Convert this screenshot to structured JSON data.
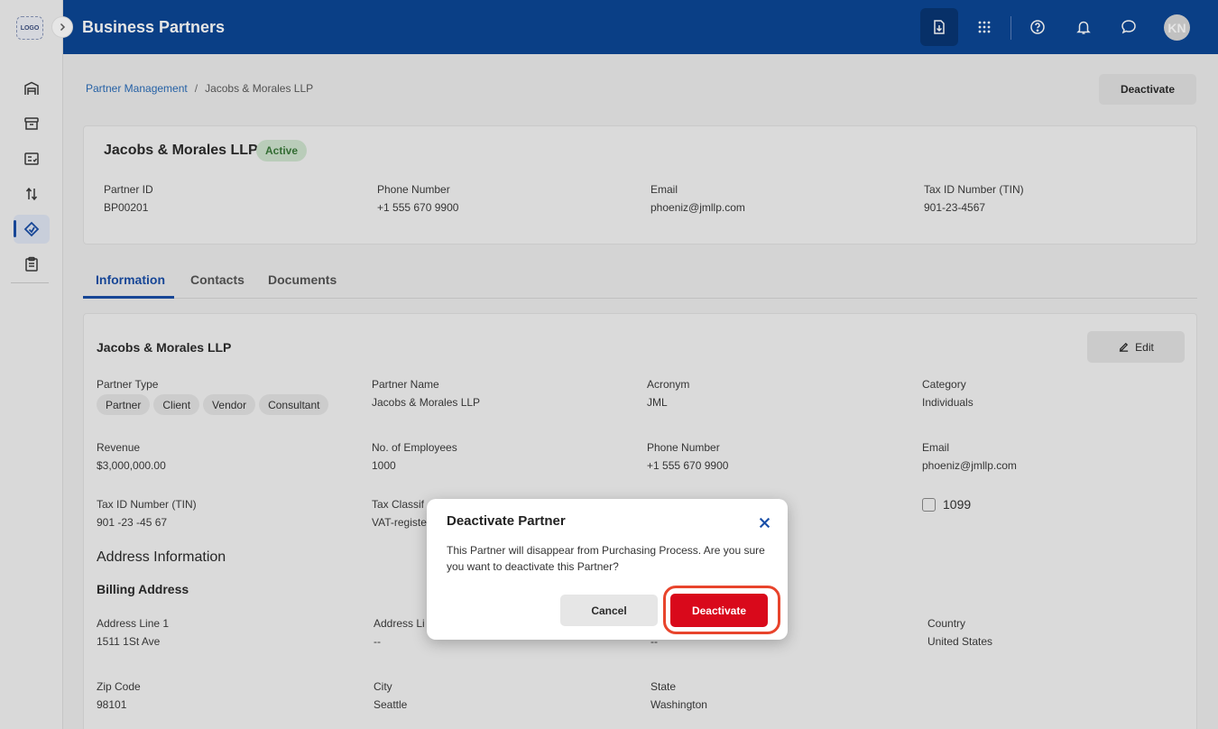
{
  "sidebar": {
    "logo_text": "LOGO",
    "items": [
      {
        "icon": "warehouse-icon"
      },
      {
        "icon": "archive-icon"
      },
      {
        "icon": "checklist-icon"
      },
      {
        "icon": "sort-icon"
      },
      {
        "icon": "partner-tag-icon",
        "active": true
      },
      {
        "icon": "clipboard-icon"
      }
    ]
  },
  "header": {
    "title": "Business Partners",
    "avatar_initials": "KN"
  },
  "breadcrumb": {
    "parent": "Partner Management",
    "separator": "/",
    "current": "Jacobs & Morales LLP"
  },
  "actions": {
    "deactivate_label": "Deactivate"
  },
  "partner": {
    "name": "Jacobs & Morales LLP",
    "status": "Active",
    "fields": [
      {
        "label": "Partner ID",
        "value": "BP00201"
      },
      {
        "label": "Phone Number",
        "value": "+1 555 670 9900"
      },
      {
        "label": "Email",
        "value": "phoeniz@jmllp.com"
      },
      {
        "label": "Tax ID Number (TIN)",
        "value": "901-23-4567"
      }
    ]
  },
  "tabs": [
    {
      "label": "Information",
      "active": true
    },
    {
      "label": "Contacts"
    },
    {
      "label": "Documents"
    }
  ],
  "info": {
    "title": "Jacobs & Morales LLP",
    "edit_label": "Edit",
    "partner_type_label": "Partner Type",
    "partner_types": [
      "Partner",
      "Client",
      "Vendor",
      "Consultant"
    ],
    "partner_name_label": "Partner Name",
    "partner_name_value": "Jacobs & Morales LLP",
    "acronym_label": "Acronym",
    "acronym_value": "JML",
    "category_label": "Category",
    "category_value": "Individuals",
    "revenue_label": "Revenue",
    "revenue_value": "$3,000,000.00",
    "employees_label": "No. of Employees",
    "employees_value": "1000",
    "phone_label": "Phone Number",
    "phone_value": "+1 555 670 9900",
    "email_label": "Email",
    "email_value": "phoeniz@jmllp.com",
    "tin_label": "Tax ID Number (TIN)",
    "tin_value": "901 -23 -45 67",
    "tax_class_label": "Tax Classif",
    "tax_class_value": "VAT-registe",
    "checkbox_label": "1099",
    "checkbox_checked": false
  },
  "address": {
    "section_title": "Address Information",
    "billing_title": "Billing Address",
    "line1_label": "Address Line 1",
    "line1_value": "1511 1St Ave",
    "line2_label": "Address Li",
    "line2_value": "--",
    "col3_value": "--",
    "country_label": "Country",
    "country_value": "United States",
    "zip_label": "Zip Code",
    "zip_value": "98101",
    "city_label": "City",
    "city_value": "Seattle",
    "state_label": "State",
    "state_value": "Washington"
  },
  "dialog": {
    "title": "Deactivate Partner",
    "message": "This Partner will disappear from Purchasing Process. Are you sure you want to deactivate this Partner?",
    "cancel_label": "Cancel",
    "confirm_label": "Deactivate"
  },
  "colors": {
    "header": "#0c4796",
    "primary": "#1a4fa8",
    "danger": "#d9091b",
    "highlight_ring": "#e8442c",
    "active_badge_bg": "#cfe4cf",
    "active_badge_text": "#3a7a3a"
  }
}
